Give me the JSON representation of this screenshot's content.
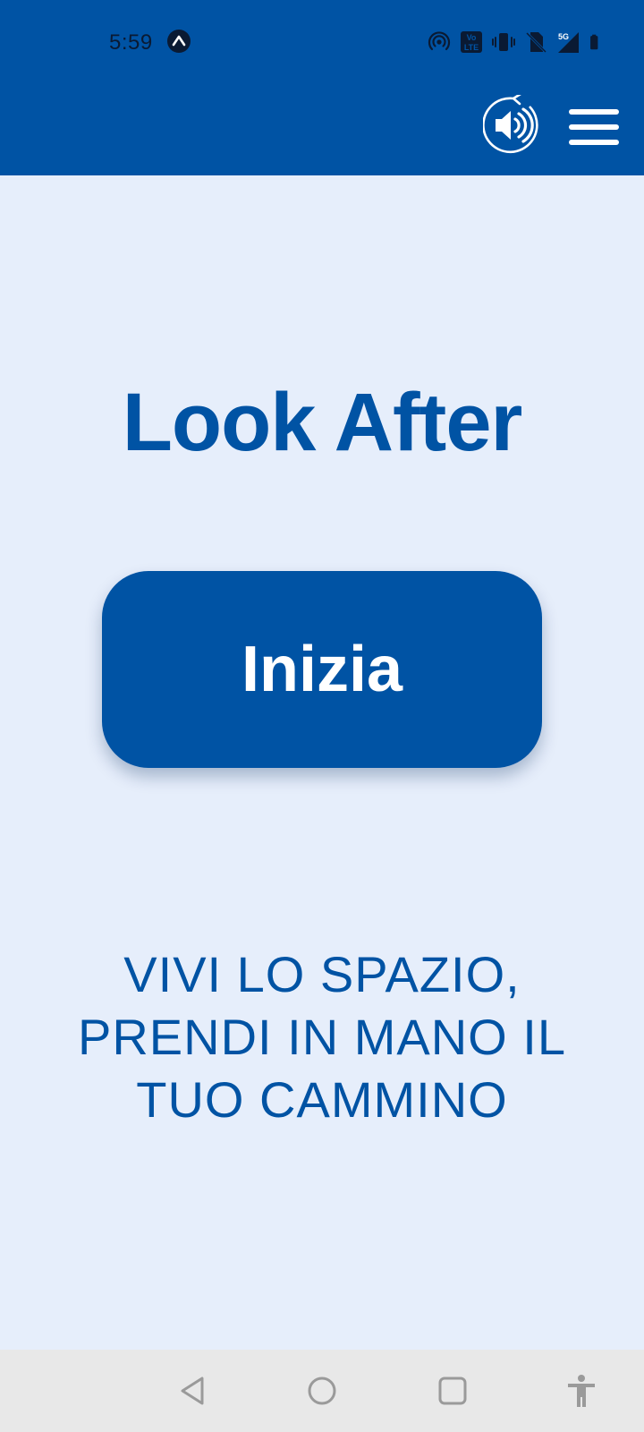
{
  "status_bar": {
    "time": "5:59",
    "icons": [
      "app-notification-icon",
      "hotspot-icon",
      "volte-icon",
      "vibrate-icon",
      "no-sim-icon",
      "5g-signal-icon",
      "battery-icon"
    ]
  },
  "toolbar": {
    "sound_icon": "speaker-replay-icon",
    "menu_icon": "hamburger-menu-icon"
  },
  "main": {
    "title": "Look After",
    "start_button_label": "Inizia",
    "tagline_lines": [
      "VIVI LO SPAZIO,",
      "PRENDI IN MANO IL",
      "TUO CAMMINO"
    ]
  },
  "nav_bar": {
    "buttons": [
      "back-icon",
      "home-icon",
      "recents-icon",
      "accessibility-icon"
    ]
  },
  "colors": {
    "brand": "#0053A4",
    "background": "#E6EEFB",
    "nav_background": "#E8E8E8"
  }
}
